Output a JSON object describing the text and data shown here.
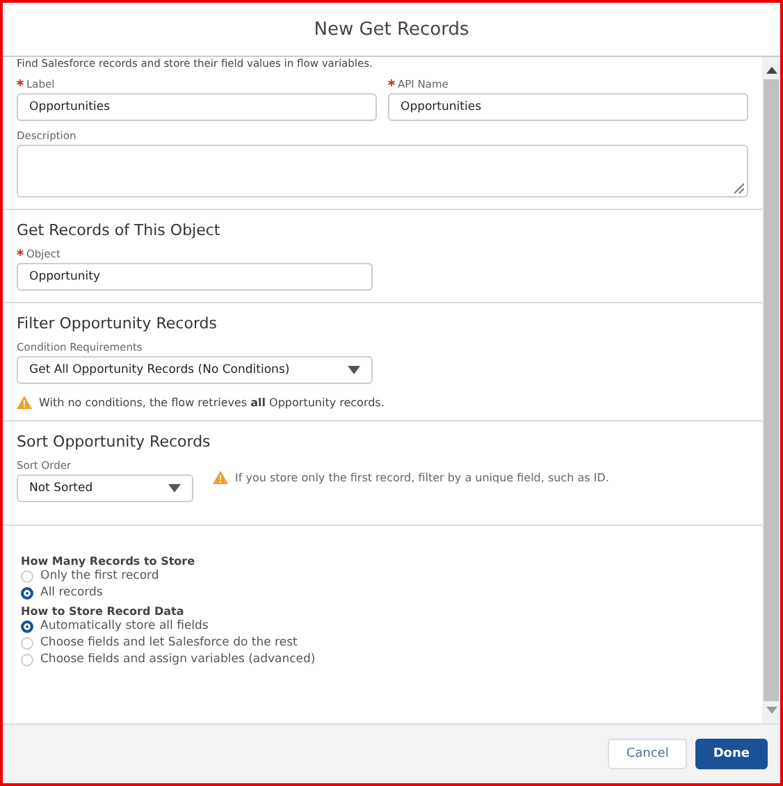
{
  "modal": {
    "title": "New Get Records"
  },
  "intro": "Find Salesforce records and store their field values in flow variables.",
  "label_fields": [
    {
      "label": "Label",
      "required": true,
      "value": "Opportunities"
    },
    {
      "label": "API Name",
      "required": true,
      "value": "Opportunities"
    }
  ],
  "description": {
    "label": "Description"
  },
  "sections": [
    {
      "kind": "object",
      "heading": "Get Records of This Object",
      "field": {
        "label": "Object",
        "required": true,
        "value": "Opportunity"
      }
    },
    {
      "kind": "filter",
      "heading": "Filter Opportunity Records",
      "field": {
        "label": "Condition Requirements",
        "required": false,
        "value": "Get All Opportunity Records (No Conditions)"
      },
      "warning": "With no conditions, the flow retrieves **all** Opportunity records."
    },
    {
      "kind": "sort",
      "heading": "Sort Opportunity Records",
      "field": {
        "label": "Sort Order",
        "required": false,
        "value": "Not Sorted"
      },
      "warning": "If you store only the first record, filter by a unique field, such as ID."
    }
  ],
  "radio_groups": [
    {
      "label": "How Many Records to Store",
      "options": [
        {
          "label": "Only the first record",
          "selected": false
        },
        {
          "label": "All records",
          "selected": true
        }
      ]
    },
    {
      "label": "How to Store Record Data",
      "options": [
        {
          "label": "Automatically store all fields",
          "selected": true
        },
        {
          "label": "Choose fields and let Salesforce do the rest",
          "selected": false
        },
        {
          "label": "Choose fields and assign variables (advanced)",
          "selected": false
        }
      ]
    }
  ],
  "buttons": [
    {
      "kind": "neutral",
      "label": "Cancel"
    },
    {
      "kind": "brand",
      "label": "Done"
    }
  ]
}
